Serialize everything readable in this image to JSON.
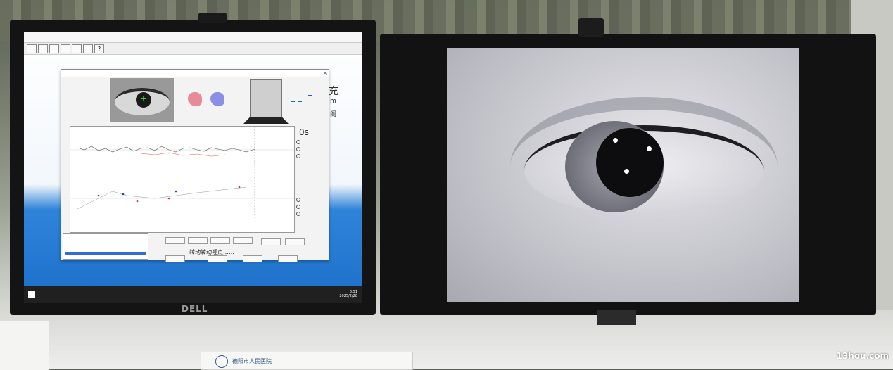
{
  "brand_logo": "DELL",
  "watermark": "13hou.com",
  "desk_card": {
    "text": "德阳市人民医院"
  },
  "left_screen": {
    "dialog": {
      "big_char": "充",
      "side_chars": [
        "m",
        "阁"
      ],
      "time": "0s",
      "bottom_hint": "转动转动视点……"
    },
    "taskbar": {
      "time": "8:51",
      "date": "2025/2/28"
    }
  },
  "colors": {
    "accent_blue": "#2f6ed8",
    "crosshair_green": "#43d13a",
    "taskbar": "#202020",
    "bezel": "#141414"
  }
}
